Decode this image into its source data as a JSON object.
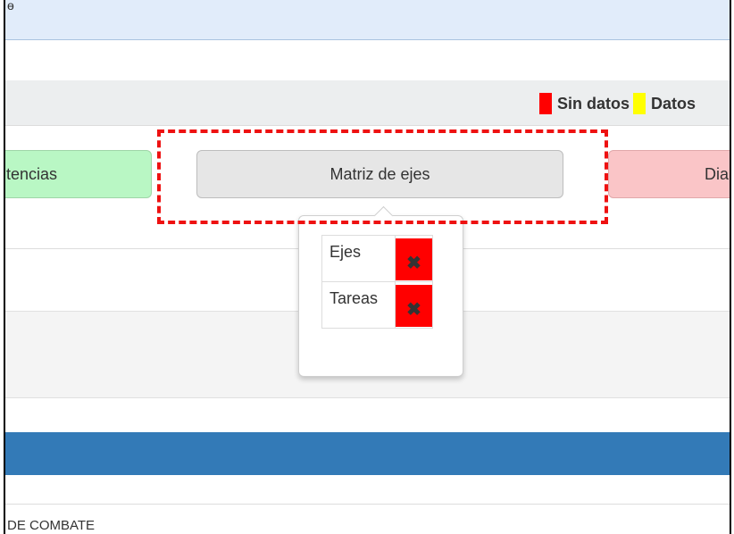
{
  "legend": {
    "items": [
      {
        "label": "Sin datos",
        "color": "#ff0000"
      },
      {
        "label": "Datos",
        "color": "#ffff00"
      }
    ]
  },
  "buttons": {
    "competencias": "tencias",
    "matrix": "Matriz de ejes",
    "diag": "Dia"
  },
  "popover": {
    "rows": [
      {
        "label": "Ejes",
        "status_icon": "x-icon",
        "status_color": "#ff0000"
      },
      {
        "label": "Tareas",
        "status_icon": "x-icon",
        "status_color": "#ff0000"
      }
    ]
  },
  "footer": {
    "text": "DE COMBATE"
  },
  "colors": {
    "blue_bar": "#337ab7",
    "highlight": "#ee1111"
  }
}
